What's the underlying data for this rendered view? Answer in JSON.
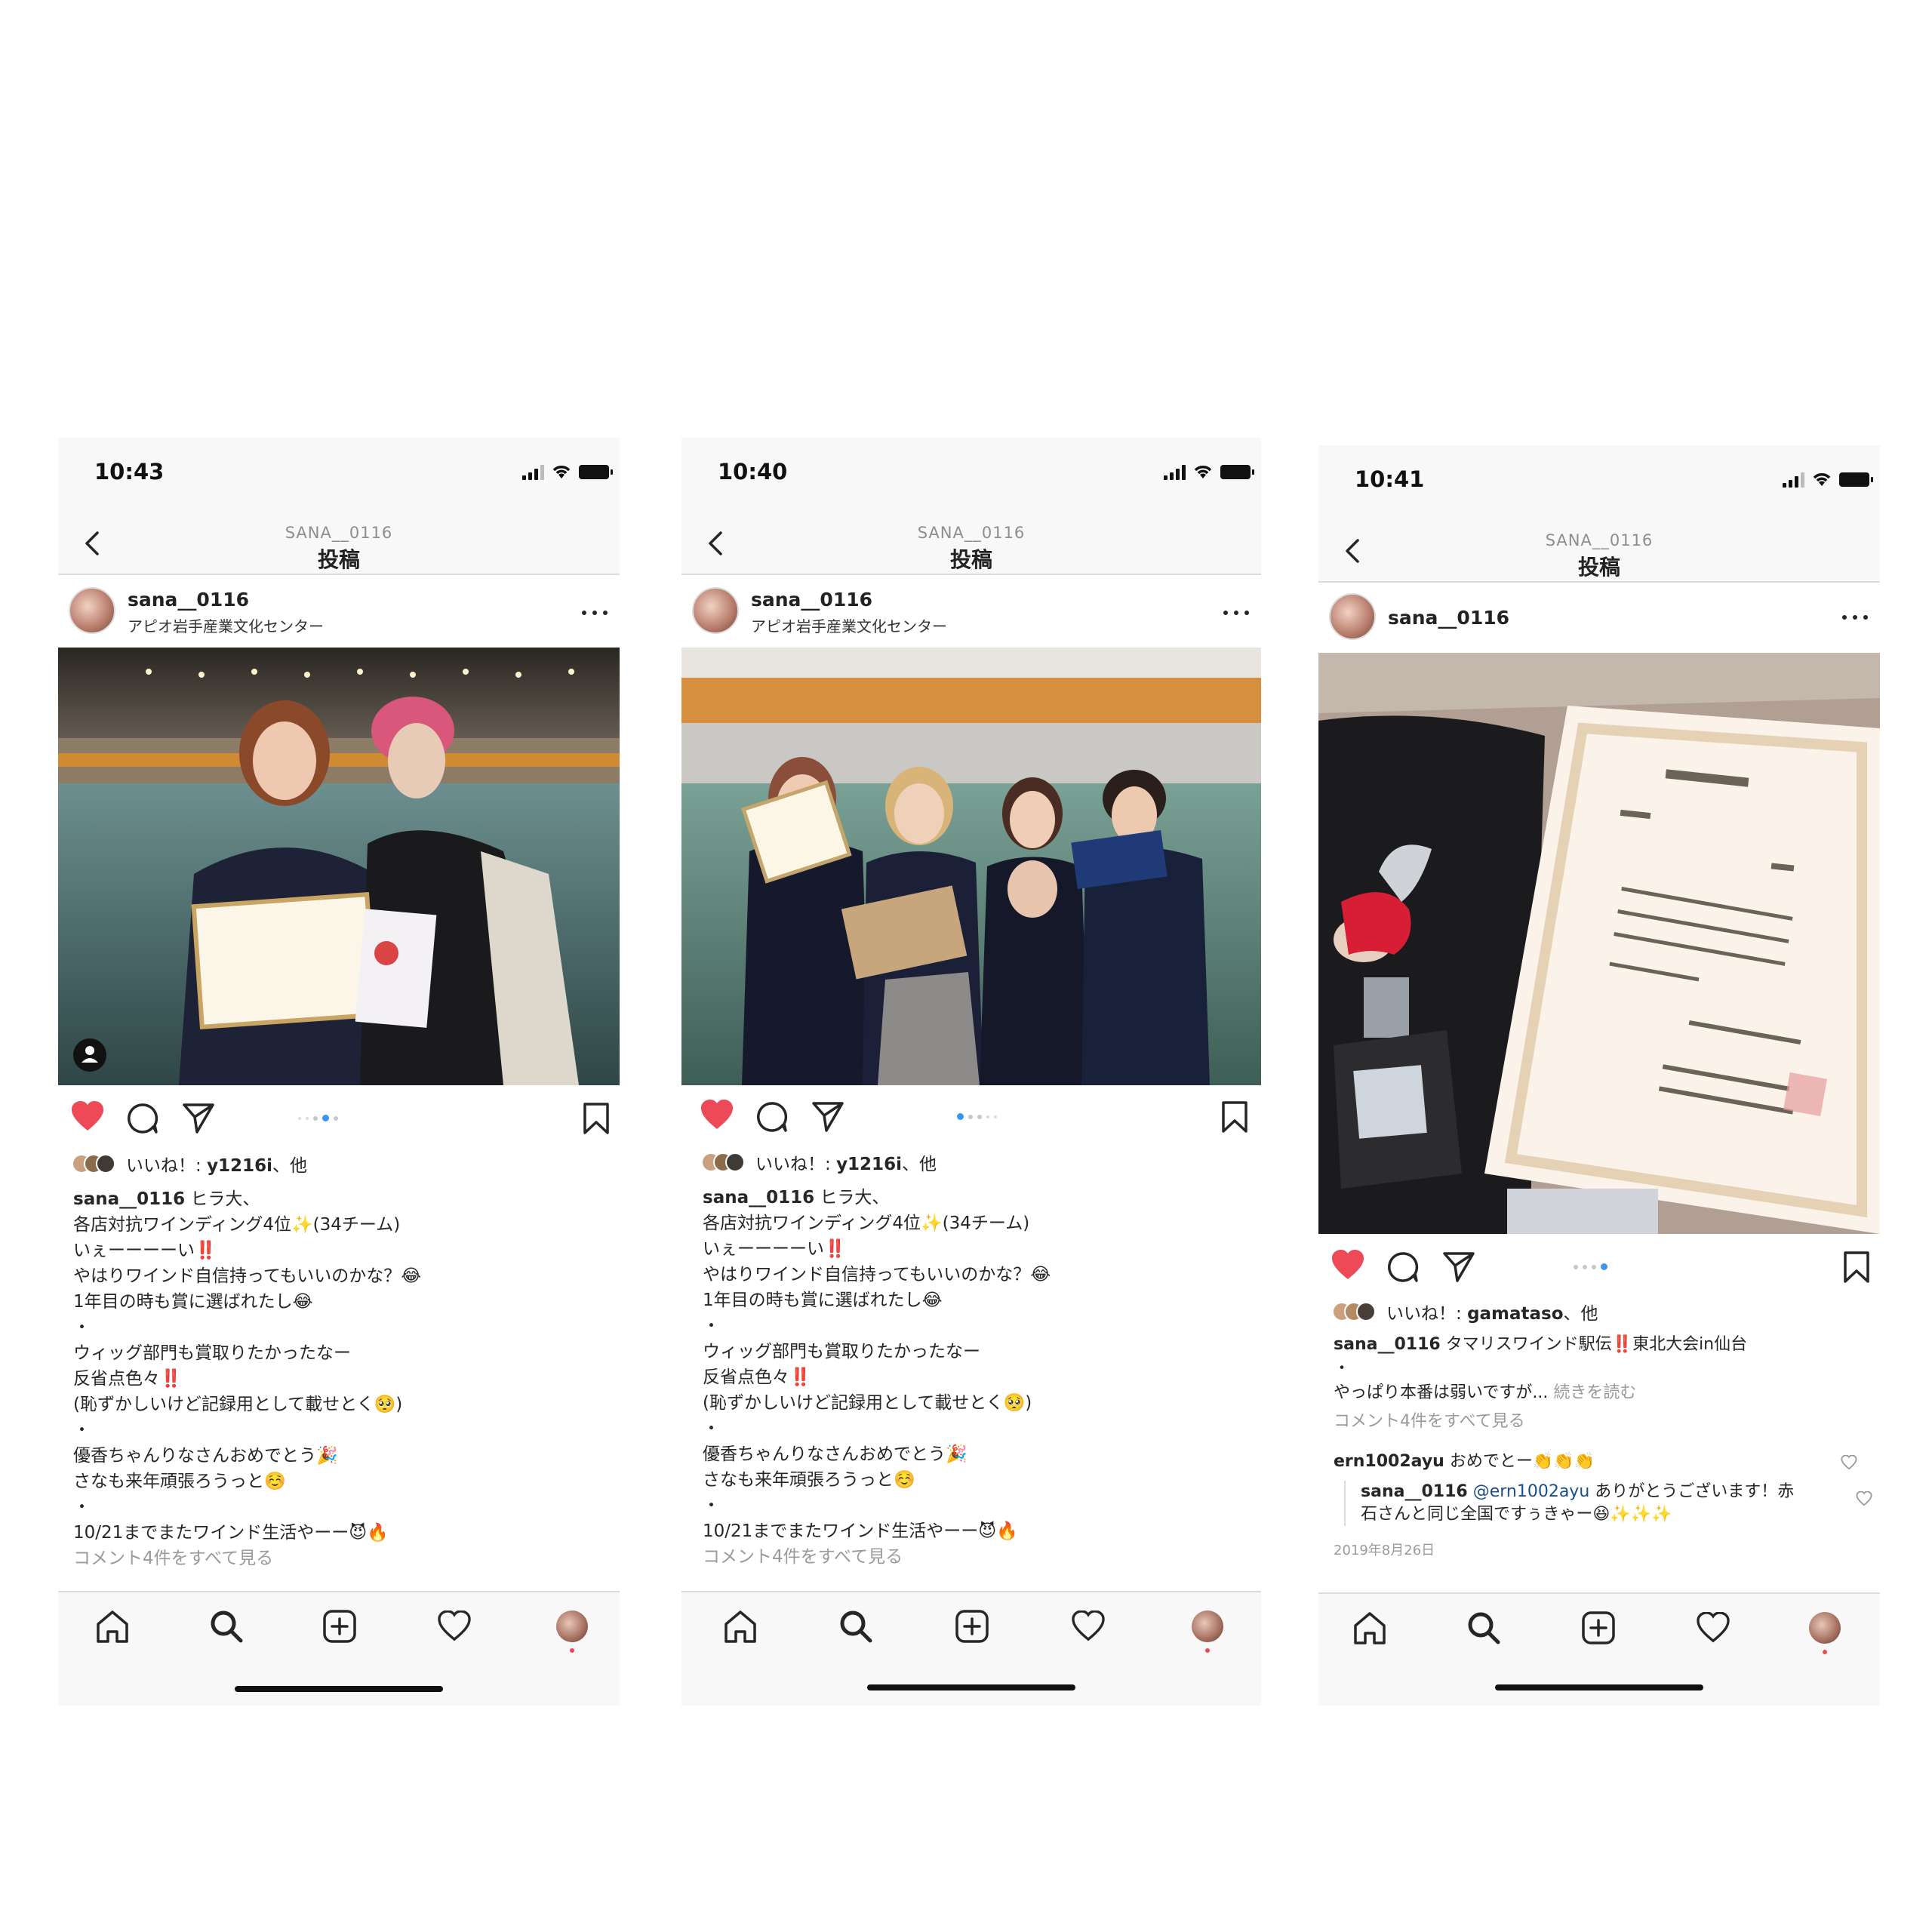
{
  "screens": [
    {
      "time": "10:43",
      "nav_user": "SANA__0116",
      "nav_title": "投稿",
      "username": "sana__0116",
      "location": "アピオ岩手産業文化センター",
      "likes_prefix": "いいね！: ",
      "likes_user": "y1216i",
      "likes_suffix": "、他",
      "caption_user": "sana__0116",
      "caption_lines": [
        " ヒラ大、",
        "各店対抗ワインディング4位✨(34チーム)",
        "いぇーーーーい‼️",
        "やはりワインド自信持ってもいいのかな？😂",
        "1年目の時も賞に選ばれたし😂",
        "・",
        "ウィッグ部門も賞取りたかったなー",
        "反省点色々‼️",
        "(恥ずかしいけど記録用として載せとく🥺)",
        "・",
        "優香ちゃんりなさんおめでとう🎉",
        "さなも来年頑張ろうっと☺️",
        "・",
        "10/21までまたワインド生活やーー😈🔥"
      ],
      "view_comments": "コメント4件をすべて見る"
    },
    {
      "time": "10:40",
      "nav_user": "SANA__0116",
      "nav_title": "投稿",
      "username": "sana__0116",
      "location": "アピオ岩手産業文化センター",
      "likes_prefix": "いいね！: ",
      "likes_user": "y1216i",
      "likes_suffix": "、他",
      "caption_user": "sana__0116",
      "caption_lines": [
        " ヒラ大、",
        "各店対抗ワインディング4位✨(34チーム)",
        "いぇーーーーい‼️",
        "やはりワインド自信持ってもいいのかな？😂",
        "1年目の時も賞に選ばれたし😂",
        "・",
        "ウィッグ部門も賞取りたかったなー",
        "反省点色々‼️",
        "(恥ずかしいけど記録用として載せとく🥺)",
        "・",
        "優香ちゃんりなさんおめでとう🎉",
        "さなも来年頑張ろうっと☺️",
        "・",
        "10/21までまたワインド生活やーー😈🔥"
      ],
      "view_comments": "コメント4件をすべて見る"
    },
    {
      "time": "10:41",
      "nav_user": "SANA__0116",
      "nav_title": "投稿",
      "username": "sana__0116",
      "likes_prefix": "いいね！: ",
      "likes_user": "gamataso",
      "likes_suffix": "、他",
      "caption_user": "sana__0116",
      "caption_first": " タマリスワインド駅伝‼️東北大会in仙台",
      "caption_dot": "・",
      "caption_second": "やっぱり本番は弱いですが... ",
      "read_more": "続きを読む",
      "view_comments": "コメント4件をすべて見る",
      "comment1_user": "ern1002ayu",
      "comment1_text": " おめでとー👏👏👏",
      "reply_user": "sana__0116",
      "reply_mention": "@ern1002ayu",
      "reply_text_1": " ありがとうございます！赤",
      "reply_text_2": "石さんと同じ全国ですぅきゃー😆✨✨✨",
      "date": "2019年8月26日"
    }
  ],
  "icons": [
    "back-icon",
    "more-icon",
    "heart-icon",
    "comment-icon",
    "share-icon",
    "bookmark-icon",
    "home-icon",
    "search-icon",
    "add-icon",
    "activity-icon"
  ],
  "colors": {
    "like_red": "#ed4956",
    "carousel_blue": "#3897f0",
    "mention_blue": "#1b4f8a"
  }
}
